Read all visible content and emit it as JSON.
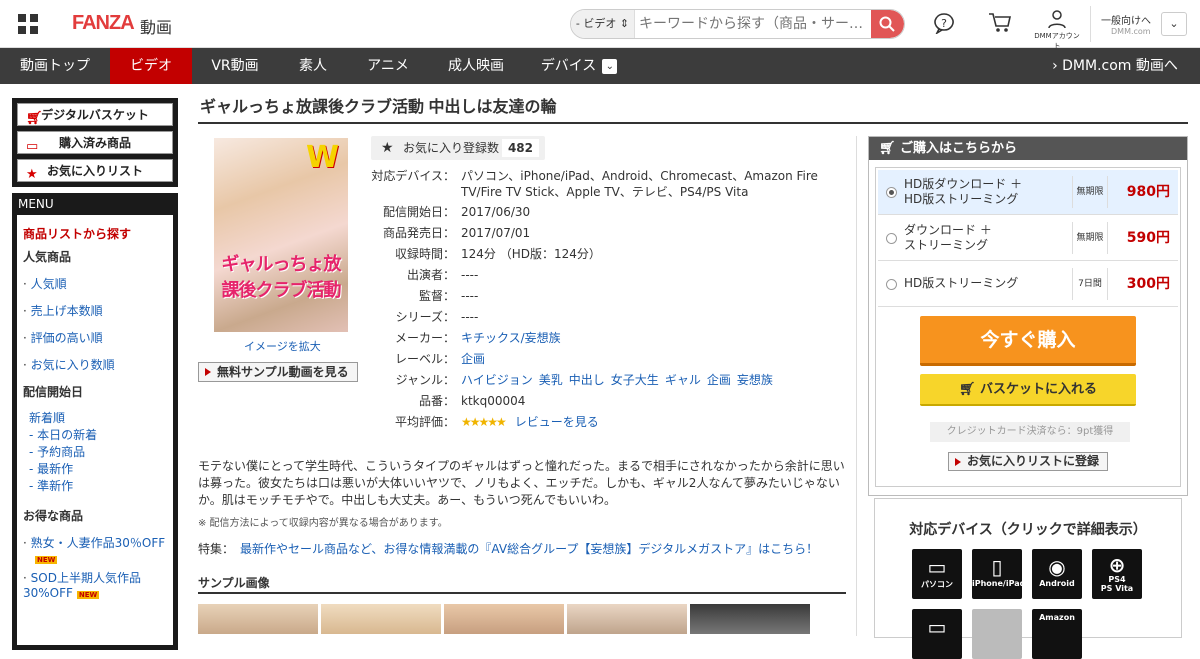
{
  "header": {
    "logo": "FANZA",
    "logo_sub": "動画",
    "search_category": "- ビデオ ⇕",
    "search_placeholder": "キーワードから探す（商品・サー…",
    "account_label": "DMMアカウント",
    "general_label": "一般向けへ",
    "general_sub": "DMM.com"
  },
  "nav": {
    "items": [
      "動画トップ",
      "ビデオ",
      "VR動画",
      "素人",
      "アニメ",
      "成人映画",
      "デバイス"
    ],
    "right": "DMM.com 動画へ"
  },
  "sidebar": {
    "buttons": [
      "デジタルバスケット",
      "購入済み商品",
      "お気に入りリスト"
    ],
    "menu_title": "MENU",
    "search_heading": "商品リストから探す",
    "popular_heading": "人気商品",
    "popular_items": [
      "人気順",
      "売上げ本数順",
      "評価の高い順",
      "お気に入り数順"
    ],
    "date_heading": "配信開始日",
    "date_items": [
      "新着順",
      "- 本日の新着",
      "- 予約商品",
      "- 最新作",
      "- 準新作"
    ],
    "deal_heading": "お得な商品",
    "deal_items": [
      "熟女・人妻作品30％OFF",
      "SOD上半期人気作品30%OFF"
    ],
    "new_badge": "NEW"
  },
  "product": {
    "title": "ギャルっちょ放課後クラブ活動 中出しは友達の輪",
    "cover_title": "ギャルっちょ放課後クラブ活動",
    "cover_w": "W",
    "enlarge": "イメージを拡大",
    "sample_button": "無料サンプル動画を見る",
    "fav_label": "お気に入り登録数",
    "fav_count": "482",
    "rows": [
      {
        "k": "対応デバイス：",
        "v": "パソコン、iPhone/iPad、Android、Chromecast、Amazon Fire TV/Fire TV Stick、Apple TV、テレビ、PS4/PS Vita"
      },
      {
        "k": "配信開始日：",
        "v": "2017/06/30"
      },
      {
        "k": "商品発売日：",
        "v": "2017/07/01"
      },
      {
        "k": "収録時間：",
        "v": "124分 （HD版：124分）"
      },
      {
        "k": "出演者：",
        "v": "----"
      },
      {
        "k": "監督：",
        "v": "----"
      },
      {
        "k": "シリーズ：",
        "v": "----"
      },
      {
        "k": "メーカー：",
        "link": "キチックス/妄想族"
      },
      {
        "k": "レーベル：",
        "link": "企画"
      },
      {
        "k": "品番：",
        "v": "ktkq00004"
      }
    ],
    "genre_key": "ジャンル：",
    "genres": [
      "ハイビジョン",
      "美乳",
      "中出し",
      "女子大生",
      "ギャル",
      "企画",
      "妄想族"
    ],
    "rating_key": "平均評価：",
    "rating_stars": "★★★★★",
    "rating": 4.5,
    "review_link": "レビューを見る",
    "description": "モテない僕にとって学生時代、こういうタイプのギャルはずっと憧れだった。まるで相手にされなかったから余計に思いは募った。彼女たちは口は悪いが大体いいヤツで、ノリもよく、エッチだ。しかも、ギャル2人なんて夢みたいじゃないか。肌はモッチモチやで。中出しも大丈夫。あー、もういつ死んでもいいわ。",
    "note": "※ 配信方法によって収録内容が異なる場合があります。",
    "feature_key": "特集：",
    "feature_link": "最新作やセール商品など、お得な情報満載の『AV総合グループ【妄想族】デジタルメガストア』はこちら！",
    "sample_heading": "サンプル画像"
  },
  "purchase": {
    "heading": "ご購入はこちらから",
    "options": [
      {
        "label1": "HD版ダウンロード ＋",
        "label2": "HD版ストリーミング",
        "period": "無期限",
        "price": "980円"
      },
      {
        "label1": "ダウンロード ＋",
        "label2": "ストリーミング",
        "period": "無期限",
        "price": "590円"
      },
      {
        "label1": "HD版ストリーミング",
        "label2": "",
        "period": "7日間",
        "price": "300円"
      }
    ],
    "buy_now": "今すぐ購入",
    "add_basket": "バスケットに入れる",
    "credit_note": "クレジットカード決済なら：9pt獲得",
    "add_fav": "お気に入りリストに登録"
  },
  "devices": {
    "heading": "対応デバイス（クリックで詳細表示）",
    "items": [
      "パソコン",
      "iPhone/iPad",
      "Android",
      "PS4\nPS Vita"
    ],
    "amazon": "Amazon"
  },
  "colors": {
    "accent": "#c20000",
    "nav": "#3c3c3c",
    "buy": "#f7931e",
    "basket": "#f7d52a",
    "link": "#1a5fb4"
  }
}
